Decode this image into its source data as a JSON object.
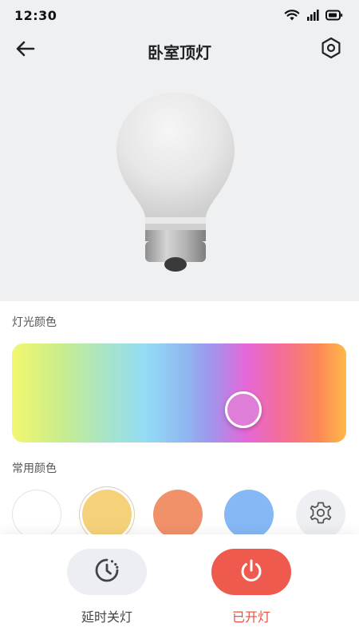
{
  "status_bar": {
    "time": "12:30",
    "icons": [
      "wifi-icon",
      "signal-icon",
      "battery-icon"
    ]
  },
  "header": {
    "title": "卧室顶灯",
    "back_icon": "arrow-left-icon",
    "settings_icon": "hexagon-settings-icon"
  },
  "device": {
    "image": "light-bulb"
  },
  "light_color": {
    "label": "灯光颜色",
    "selected_color": "#de7ed8"
  },
  "common_colors": {
    "label": "常用颜色",
    "swatches": [
      "#ffffff",
      "#f5d27a",
      "#f0916a",
      "#86b8f5"
    ],
    "selected_index": 1,
    "custom_icon": "gear-icon"
  },
  "actions": {
    "timer": {
      "label": "延时关灯",
      "icon": "timer-icon"
    },
    "power": {
      "label": "已开灯",
      "icon": "power-icon",
      "color": "#ee5b4e"
    }
  }
}
